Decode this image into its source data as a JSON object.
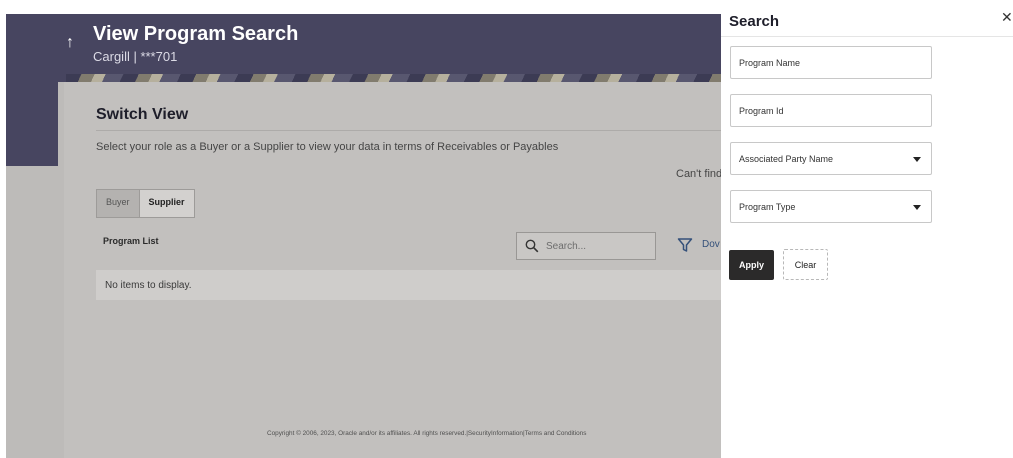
{
  "header": {
    "title": "View Program Search",
    "subtitle": "Cargill | ***701",
    "back_icon": "arrow-up-icon"
  },
  "main": {
    "card_title": "Switch View",
    "description": "Select your role as a Buyer or a Supplier to view your data in terms of Receivables or Payables",
    "cant_find": "Can't find",
    "toggle": {
      "buyer": "Buyer",
      "supplier": "Supplier",
      "selected": "Supplier"
    },
    "program_list_label": "Program List",
    "search_placeholder": "Search...",
    "download_label": "Dov",
    "empty_message": "No items to display."
  },
  "footer": {
    "text": "Copyright © 2006, 2023, Oracle and/or its affiliates. All rights reserved.|SecurityInformation|Terms and Conditions"
  },
  "search_panel": {
    "title": "Search",
    "close_icon": "close-icon",
    "fields": {
      "program_name": "Program Name",
      "program_id": "Program Id",
      "associated_party_name": "Associated Party Name",
      "program_type": "Program Type"
    },
    "apply_label": "Apply",
    "clear_label": "Clear"
  },
  "colors": {
    "header": "#474560",
    "overlay_bg": "#bdbbb9",
    "apply_button": "#2b2a2a",
    "link": "#34507a"
  }
}
